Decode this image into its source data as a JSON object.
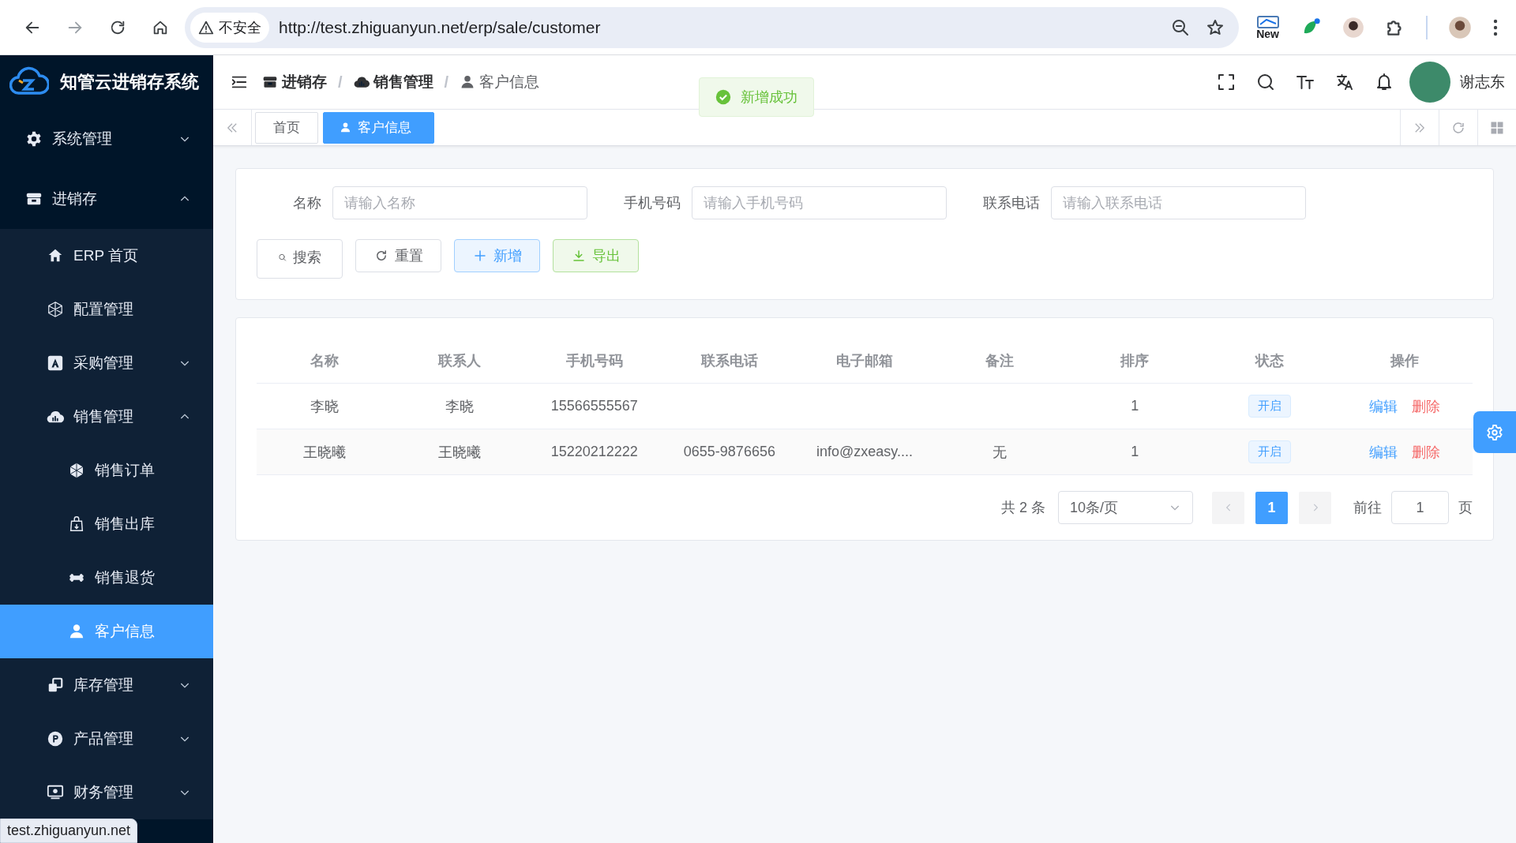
{
  "browser": {
    "security": "不安全",
    "url": "http://test.zhiguanyun.net/erp/sale/customer",
    "extension_badge": "New",
    "status_url": "test.zhiguanyun.net"
  },
  "sidebar": {
    "title": "知管云进销存系统",
    "items": [
      {
        "label": "系统管理",
        "kind": "gear",
        "expanded": false,
        "selected": false
      },
      {
        "label": "进销存",
        "kind": "store",
        "expanded": true,
        "selected": false,
        "children": [
          {
            "label": "ERP 首页",
            "kind": "home",
            "selected": false
          },
          {
            "label": "配置管理",
            "kind": "hexagon",
            "selected": false
          },
          {
            "label": "采购管理",
            "kind": "letter-a",
            "expanded": false,
            "selected": false
          },
          {
            "label": "销售管理",
            "kind": "cloud-chart",
            "expanded": true,
            "selected": false,
            "children": [
              {
                "label": "销售订单",
                "kind": "sphere",
                "selected": false
              },
              {
                "label": "销售出库",
                "kind": "bag",
                "selected": false
              },
              {
                "label": "销售退货",
                "kind": "bone",
                "selected": false
              },
              {
                "label": "客户信息",
                "kind": "user",
                "selected": true
              }
            ]
          },
          {
            "label": "库存管理",
            "kind": "boxes",
            "expanded": false,
            "selected": false
          },
          {
            "label": "产品管理",
            "kind": "letter-p",
            "expanded": false,
            "selected": false
          },
          {
            "label": "财务管理",
            "kind": "monitor",
            "expanded": false,
            "selected": false
          }
        ]
      }
    ]
  },
  "header": {
    "breadcrumb": [
      {
        "label": "进销存",
        "kind": "store",
        "selected": false
      },
      {
        "label": "销售管理",
        "kind": "cloud-chart",
        "selected": false
      },
      {
        "label": "客户信息",
        "kind": "user",
        "selected": true
      }
    ],
    "separator": "/",
    "user": "谢志东"
  },
  "toast": {
    "text": "新增成功"
  },
  "tabs": [
    {
      "label": "首页",
      "kind": "plain",
      "selected": false
    },
    {
      "label": "客户信息",
      "kind": "user",
      "selected": true
    }
  ],
  "search": {
    "fields": [
      {
        "label": "名称",
        "placeholder": "请输入名称"
      },
      {
        "label": "手机号码",
        "placeholder": "请输入手机号码"
      },
      {
        "label": "联系电话",
        "placeholder": "请输入联系电话"
      }
    ],
    "buttons": [
      {
        "label": "搜索",
        "kind": "search"
      },
      {
        "label": "重置",
        "kind": "reset"
      },
      {
        "label": "新增",
        "kind": "add"
      },
      {
        "label": "导出",
        "kind": "export"
      }
    ]
  },
  "table": {
    "columns": [
      "名称",
      "联系人",
      "手机号码",
      "联系电话",
      "电子邮箱",
      "备注",
      "排序",
      "状态",
      "操作"
    ],
    "rows": [
      {
        "name": "李晓",
        "contact": "李晓",
        "mobile": "15566555567",
        "sort": "1",
        "status": "开启",
        "actions": [
          {
            "label": "编辑",
            "kind": "edit"
          },
          {
            "label": "删除",
            "kind": "delete"
          }
        ]
      },
      {
        "name": "王晓曦",
        "contact": "王晓曦",
        "mobile": "15220212222",
        "phone": "0655-9876656",
        "email": "info@zxeasy....",
        "remark": "无",
        "sort": "1",
        "status": "开启",
        "actions": [
          {
            "label": "编辑",
            "kind": "edit"
          },
          {
            "label": "删除",
            "kind": "delete"
          }
        ]
      }
    ]
  },
  "pagination": {
    "total": "共 2 条",
    "page_size": "10条/页",
    "pages": [
      {
        "label": "1",
        "selected": true
      }
    ],
    "goto_label": "前往",
    "goto_value": "1",
    "goto_suffix": "页"
  }
}
